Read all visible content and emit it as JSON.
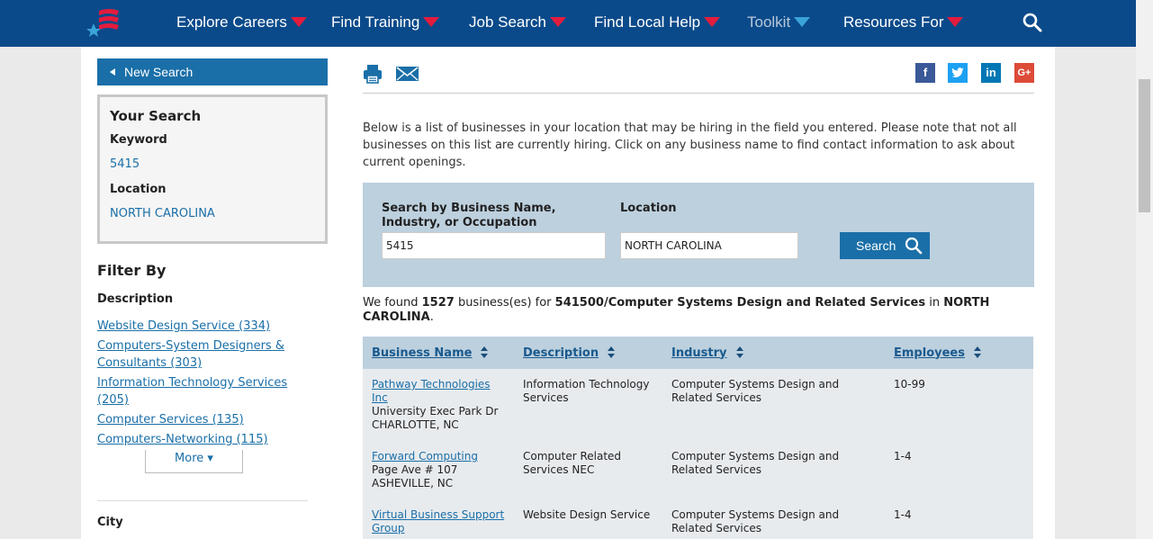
{
  "nav": {
    "items": [
      {
        "label": "Explore Careers"
      },
      {
        "label": "Find Training"
      },
      {
        "label": "Job Search"
      },
      {
        "label": "Find Local Help"
      },
      {
        "label": "Toolkit"
      },
      {
        "label": "Resources For"
      }
    ]
  },
  "sidebar": {
    "new_search": "New Search",
    "your_search": {
      "title": "Your Search",
      "keyword_label": "Keyword",
      "keyword_value": "5415",
      "location_label": "Location",
      "location_value": "NORTH CAROLINA"
    },
    "filter_title": "Filter By",
    "description_label": "Description",
    "filters": [
      "Website Design Service (334)",
      "Computers-System Designers & Consultants (303)",
      "Information Technology Services (205)",
      "Computer Services (135)",
      "Computers-Networking (115)"
    ],
    "more_label": "More ▾",
    "city_label": "City"
  },
  "social": {
    "facebook": "f",
    "linkedin": "in",
    "googleplus": "G+"
  },
  "intro_text": "Below is a list of businesses in your location that may be hiring in the field you entered. Please note that not all businesses on this list are currently hiring. Click on any business name to find contact information to ask about current openings.",
  "search_form": {
    "business_label": "Search by Business Name, Industry, or Occupation",
    "business_value": "5415",
    "location_label": "Location",
    "location_value": "NORTH CAROLINA",
    "button_label": "Search"
  },
  "found": {
    "prefix": "We found ",
    "count": "1527",
    "middle": " business(es) for ",
    "industry": "541500/Computer Systems Design and Related Services",
    "in": " in ",
    "location": "NORTH CAROLINA",
    "suffix": "."
  },
  "table": {
    "headers": [
      "Business Name",
      "Description",
      "Industry",
      "Employees"
    ],
    "rows": [
      {
        "name": "Pathway Technologies Inc",
        "address": "University Exec Park Dr",
        "city": "CHARLOTTE, NC",
        "description": "Information Technology Services",
        "industry": "Computer Systems Design and Related Services",
        "employees": "10-99"
      },
      {
        "name": "Forward Computing",
        "address": "Page Ave # 107",
        "city": "ASHEVILLE, NC",
        "description": "Computer Related Services NEC",
        "industry": "Computer Systems Design and Related Services",
        "employees": "1-4"
      },
      {
        "name": "Virtual Business Support Group",
        "address": "",
        "city": "",
        "description": "Website Design Service",
        "industry": "Computer Systems Design and Related Services",
        "employees": "1-4"
      }
    ]
  },
  "colors": {
    "nav_bg": "#0b4a8a",
    "accent_red": "#e31c3d",
    "link_blue": "#1a6fa8",
    "search_bg": "#bdd0de"
  }
}
